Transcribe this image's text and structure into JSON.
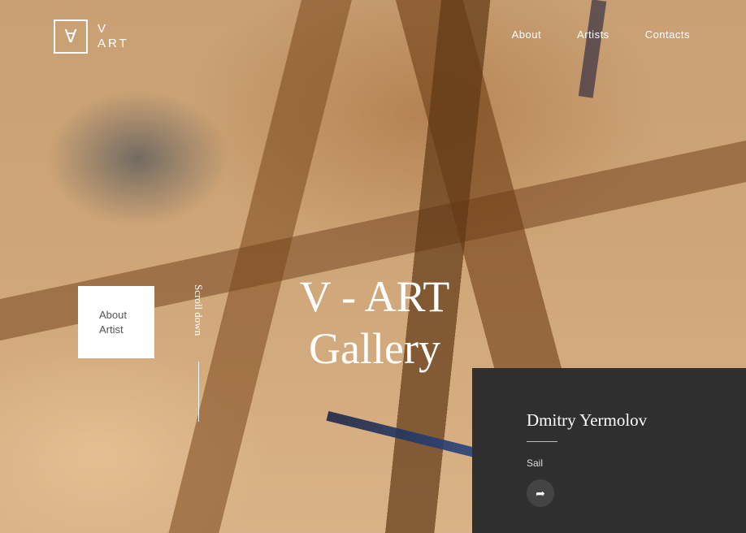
{
  "brand": {
    "mark": "∀",
    "line1": "V",
    "line2": "ART"
  },
  "nav": {
    "items": [
      "About",
      "Artists",
      "Contacts"
    ]
  },
  "about_card": {
    "line1": "About",
    "line2": "Artist"
  },
  "scroll_text": "Scroll down",
  "hero": {
    "line1": "V - ART",
    "line2": "Gallery"
  },
  "artwork": {
    "artist": "Dmitry Yermolov",
    "title": "Sail",
    "share_icon": "share-icon"
  }
}
